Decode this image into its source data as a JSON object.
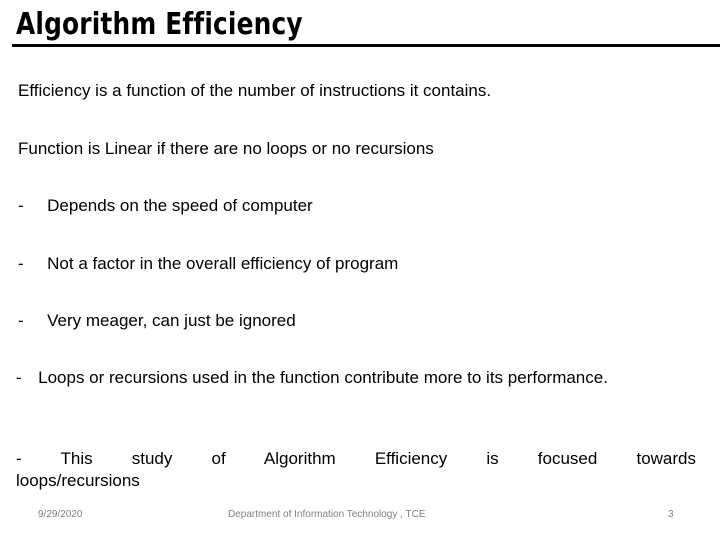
{
  "slide": {
    "title": "Algorithm Efficiency",
    "body": {
      "line1": "Efficiency is a function of the number of instructions it contains.",
      "line2": "Function is Linear if there are no loops or no recursions",
      "bullet1_marker": "-",
      "bullet1": "Depends on the speed of computer",
      "bullet2_marker": "-",
      "bullet2": "Not a factor in the overall efficiency of program",
      "bullet3_marker": "-",
      "bullet3": "Very meager, can just be ignored",
      "bullet4_marker": "-",
      "bullet4": "Loops or recursions used in the function contribute more to its performance.",
      "bullet5_marker": "-",
      "bullet5": "This study of Algorithm Efficiency is focused towards",
      "bullet5_lastline": "loops/recursions"
    },
    "footer": {
      "date": "9/29/2020",
      "center": "Department of Information Technology , TCE",
      "page_number": "3"
    },
    "colors": {
      "background": "#ffffff",
      "text": "#000000",
      "rule": "#000000",
      "footer_text": "#808080"
    }
  }
}
